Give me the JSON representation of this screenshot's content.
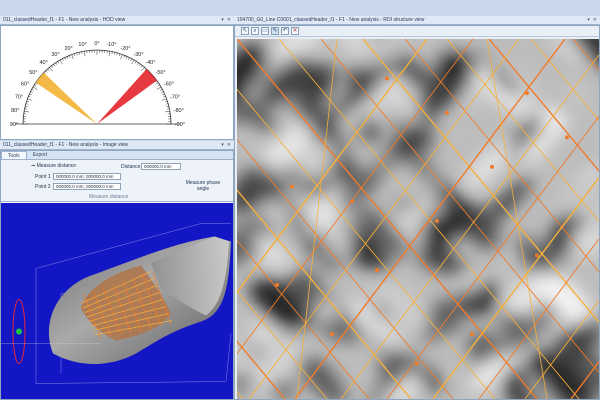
{
  "hod_view": {
    "title": "011_classedHeader_f1 - F1 - New analysis - HOD view",
    "dial": {
      "left_labels": [
        "10°",
        "20°",
        "30°",
        "40°",
        "50°",
        "60°",
        "70°",
        "80°",
        "90°"
      ],
      "right_labels": [
        "-10°",
        "-20°",
        "-30°",
        "-40°",
        "-50°",
        "-60°",
        "-70°",
        "-80°",
        "-90°"
      ],
      "top_label": "0°",
      "sector_colors": {
        "yellow": "#f2b233",
        "red": "#e3242b"
      }
    }
  },
  "roi_view": {
    "title": "104700_G0_Line C0001_classedHeader_f1 - F1 - New analysis - ROI structure view",
    "tool_icons": [
      "pointer-icon",
      "zoom-icon",
      "select-icon",
      "mark-icon",
      "undo-icon",
      "delete-icon"
    ],
    "line_colors": {
      "orange": "#f07b2a",
      "yellow": "#f5b03b"
    }
  },
  "image_view": {
    "title": "011_classedHeader_f1 - F1 - New analysis - Image view",
    "tabs": [
      "Tools",
      "Export"
    ],
    "ribbon": {
      "measure_distance_label": "Measure distance",
      "distance_label": "Distance",
      "distance_value": "000000.0 mm",
      "point1_label": "Point 1",
      "point1_value": "000000.0 mm; 000000.0 mm",
      "point2_label": "Point 2",
      "point2_value": "000000.0 mm; 000000.0 mm",
      "measure_angle_label": "Measure phase angle",
      "group_label": "Measure distance"
    }
  }
}
